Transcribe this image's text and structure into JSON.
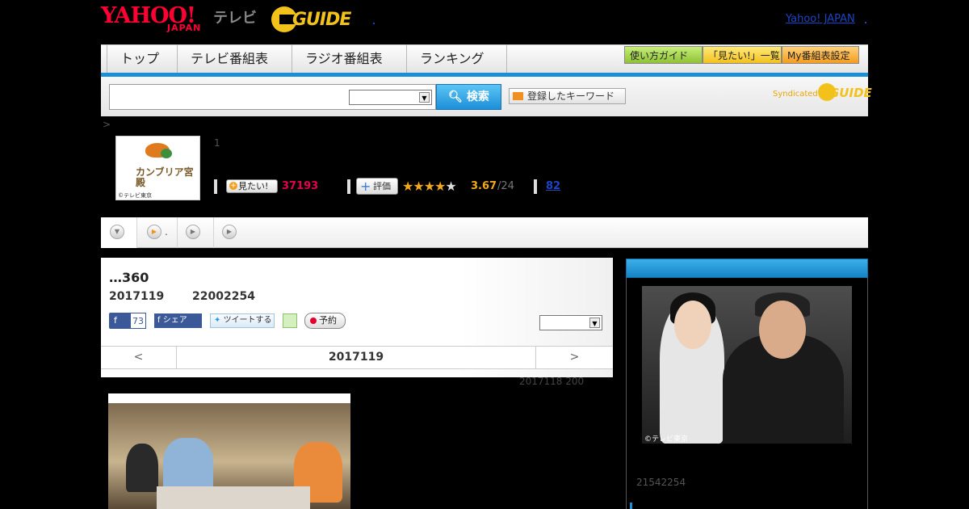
{
  "header": {
    "yahoo_logo": "YAHOO!",
    "yahoo_sub": "JAPAN",
    "tv_label": "テレビ",
    "gguide_logo": "GUIDE",
    "yahoo_japan_link": "Yahoo! JAPAN"
  },
  "nav": {
    "tabs": [
      "トップ",
      "テレビ番組表",
      "ラジオ番組表",
      "ランキング"
    ],
    "buttons": [
      "使い方ガイド",
      "「見たい!」一覧",
      "My番組表設定"
    ]
  },
  "search": {
    "placeholder": "",
    "select_value": "",
    "button_label": "検索",
    "keyword_button": "登録したキーワード",
    "syndicated_label": "Syndicated",
    "syndicated_logo": "GUIDE"
  },
  "breadcrumb": ">",
  "program": {
    "thumb_title": "カンブリア宮殿",
    "thumb_credit": "©テレビ東京",
    "episode_num": "1",
    "mitai_label": "見たい!",
    "mitai_count": "37193",
    "hyouka_label": "評価",
    "stars": "★★★★",
    "star_off": "★",
    "rating": "3.67",
    "rating_total": "/24",
    "review_count": "82"
  },
  "subtabs": [
    {
      "label": "",
      "icon": "chevron-down-icon"
    },
    {
      "label": ".",
      "icon": "play-icon"
    },
    {
      "label": "",
      "icon": "play-icon"
    },
    {
      "label": "",
      "icon": "play-icon"
    }
  ],
  "episode": {
    "title": "…360",
    "date": "2017119",
    "time": "22002254",
    "fb_count": "73",
    "fb_share": "シェア",
    "tweet": "ツイートする",
    "yoyaku": "予約",
    "select_value": "",
    "day_prev": "<",
    "day_current": "2017119",
    "day_next": ">",
    "prev_episode": "2017118  200"
  },
  "right_panel": {
    "photo_credit": "©テレビ東京",
    "time": "21542254"
  },
  "colors": {
    "accent_blue": "#1a8fd6",
    "yahoo_red": "#ff0033",
    "gguide_yellow": "#f2c21a",
    "mitai_pink": "#e5004f",
    "star_orange": "#f2a81d"
  }
}
